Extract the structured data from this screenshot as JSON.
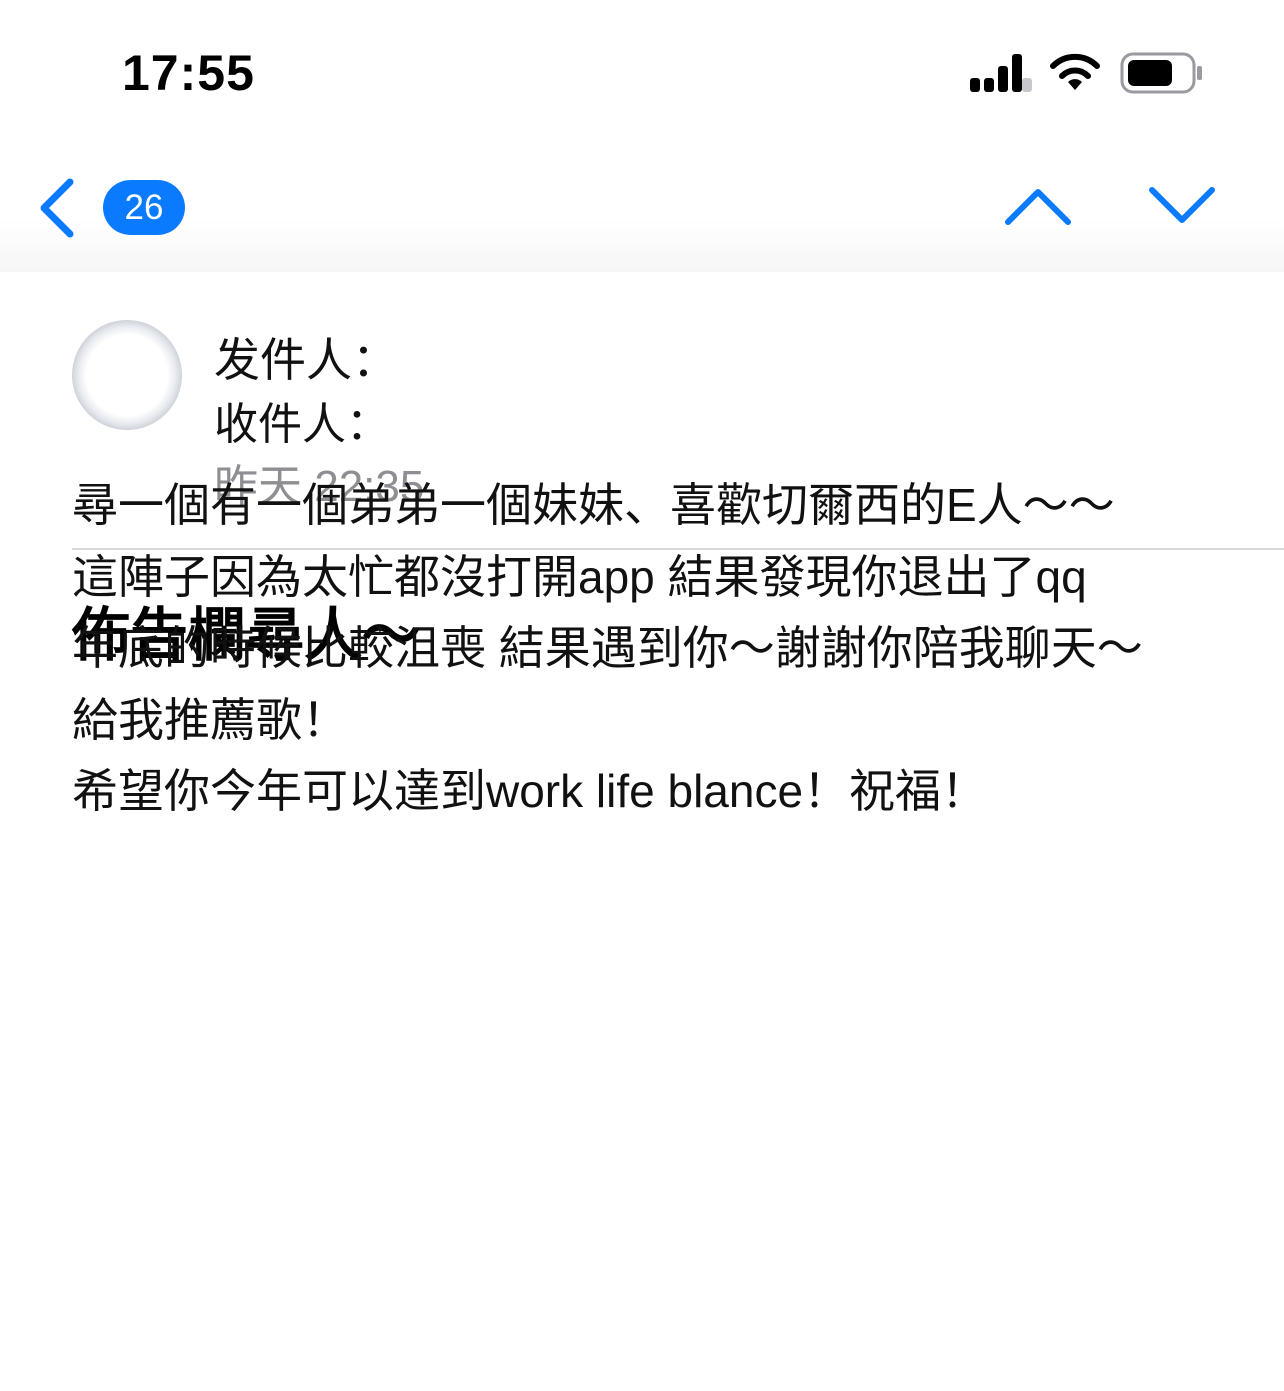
{
  "status_bar": {
    "time": "17:55"
  },
  "nav": {
    "unread_count": "26",
    "accent_color": "#0a7aff",
    "icons": [
      "chevron-left-icon",
      "chevron-up-icon",
      "chevron-down-icon"
    ]
  },
  "message": {
    "from_label": "发件人：",
    "to_label": "收件人：",
    "date": "昨天 22:35",
    "subject": "佈告欄尋人～",
    "body_lines": [
      "尋一個有一個弟弟一個妹妹、喜歡切爾西的E人～～",
      "這陣子因為太忙都沒打開app 結果發現你退出了qq",
      "年底的時候比較沮喪 結果遇到你～謝謝你陪我聊天～",
      "給我推薦歌！",
      "希望你今年可以達到work life blance！祝福！"
    ]
  }
}
